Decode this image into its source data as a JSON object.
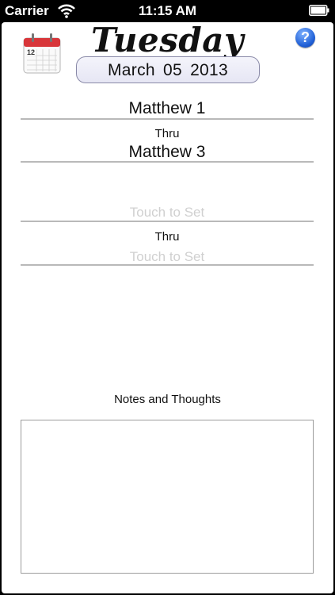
{
  "status_bar": {
    "carrier": "Carrier",
    "time": "11:15 AM",
    "icons": [
      "wifi-icon",
      "battery-icon"
    ]
  },
  "header": {
    "day": "Tuesday",
    "date": "March 05 2013",
    "calendar_icon_day": "12",
    "help_label": "?"
  },
  "reading_1": {
    "from": "Matthew 1",
    "thru_label": "Thru",
    "to": "Matthew 3"
  },
  "reading_2": {
    "from": "Touch to Set",
    "thru_label": "Thru",
    "to": "Touch to Set"
  },
  "notes": {
    "label": "Notes and Thoughts",
    "value": ""
  },
  "colors": {
    "placeholder": "#d0d0d0",
    "help_button": "#1f5fd6",
    "rule": "#b9b9b9",
    "calendar_red": "#d8363a"
  }
}
